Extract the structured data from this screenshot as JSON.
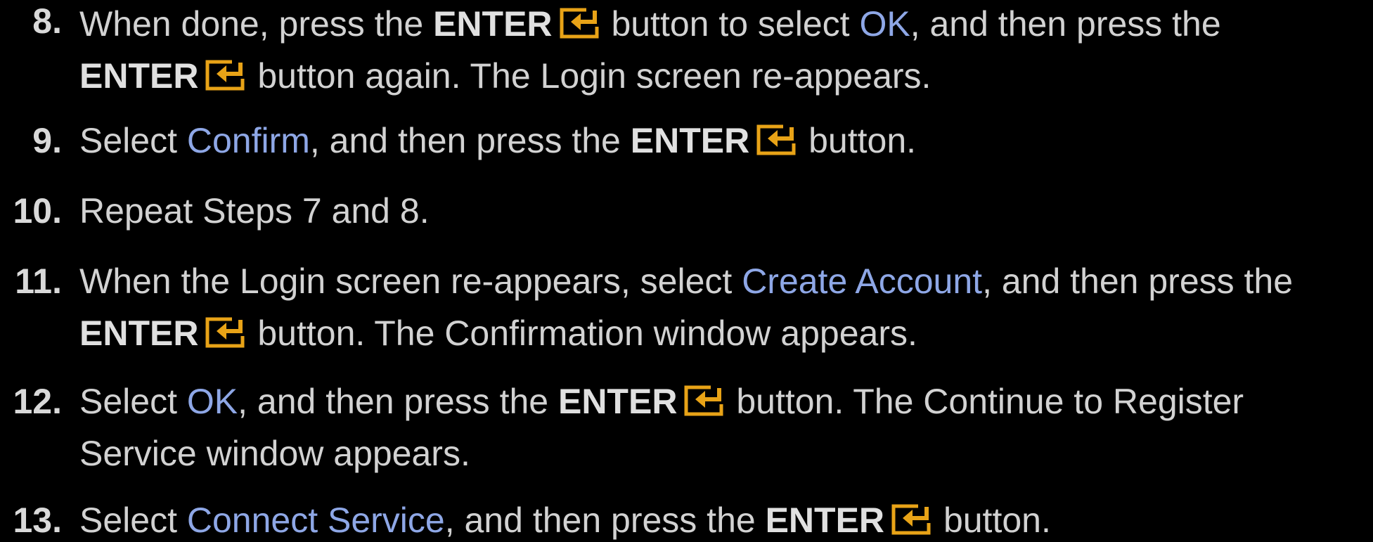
{
  "steps": [
    {
      "number": "8.",
      "lines": [
        {
          "segments": [
            {
              "t": "text",
              "v": "When done, press the "
            },
            {
              "t": "kw",
              "v": "ENTER"
            },
            {
              "t": "icon",
              "v": "enter-icon"
            },
            {
              "t": "text",
              "v": " button to select "
            },
            {
              "t": "hl",
              "v": "OK"
            },
            {
              "t": "text",
              "v": ", and then press the"
            }
          ]
        },
        {
          "segments": [
            {
              "t": "kw",
              "v": "ENTER"
            },
            {
              "t": "icon",
              "v": "enter-icon"
            },
            {
              "t": "text",
              "v": " button again. The Login screen re-appears."
            }
          ]
        }
      ]
    },
    {
      "number": "9.",
      "lines": [
        {
          "segments": [
            {
              "t": "text",
              "v": "Select "
            },
            {
              "t": "hl",
              "v": "Confirm"
            },
            {
              "t": "text",
              "v": ", and then press the "
            },
            {
              "t": "kw",
              "v": "ENTER"
            },
            {
              "t": "icon",
              "v": "enter-icon"
            },
            {
              "t": "text",
              "v": " button."
            }
          ]
        }
      ]
    },
    {
      "number": "10.",
      "lines": [
        {
          "segments": [
            {
              "t": "text",
              "v": "Repeat Steps 7 and 8."
            }
          ]
        }
      ]
    },
    {
      "number": "11.",
      "lines": [
        {
          "segments": [
            {
              "t": "text",
              "v": "When the Login screen re-appears, select "
            },
            {
              "t": "hl",
              "v": "Create Account"
            },
            {
              "t": "text",
              "v": ", and then press the"
            }
          ]
        },
        {
          "segments": [
            {
              "t": "kw",
              "v": "ENTER"
            },
            {
              "t": "icon",
              "v": "enter-icon"
            },
            {
              "t": "text",
              "v": " button. The Confirmation window appears."
            }
          ]
        }
      ]
    },
    {
      "number": "12.",
      "lines": [
        {
          "segments": [
            {
              "t": "text",
              "v": "Select "
            },
            {
              "t": "hl",
              "v": "OK"
            },
            {
              "t": "text",
              "v": ", and then press the "
            },
            {
              "t": "kw",
              "v": "ENTER"
            },
            {
              "t": "icon",
              "v": "enter-icon"
            },
            {
              "t": "text",
              "v": " button. The Continue to Register"
            }
          ]
        },
        {
          "segments": [
            {
              "t": "text",
              "v": "Service window appears."
            }
          ]
        }
      ]
    },
    {
      "number": "13.",
      "lines": [
        {
          "segments": [
            {
              "t": "text",
              "v": "Select "
            },
            {
              "t": "hl",
              "v": "Connect Service"
            },
            {
              "t": "text",
              "v": ", and then press the "
            },
            {
              "t": "kw",
              "v": "ENTER"
            },
            {
              "t": "icon",
              "v": "enter-icon"
            },
            {
              "t": "text",
              "v": " button."
            }
          ]
        }
      ]
    }
  ],
  "colors": {
    "background": "#000000",
    "text": "#d2d2d2",
    "highlight": "#8ea7e6",
    "icon": "#e8a317"
  }
}
